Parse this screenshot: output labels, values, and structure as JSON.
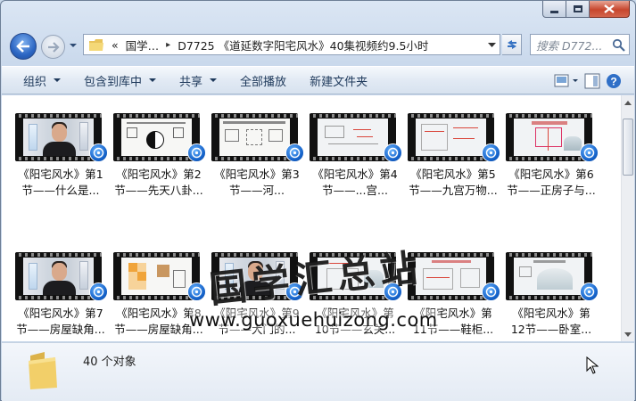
{
  "window": {
    "address": {
      "overflow": "«",
      "segments": [
        "国学…",
        "D7725 《道延数字阳宅风水》40集视频约9.5小时"
      ]
    },
    "search_placeholder": "搜索 D772..."
  },
  "toolbar": {
    "organize": "组织",
    "include_library": "包含到库中",
    "share": "共享",
    "play_all": "全部播放",
    "new_folder": "新建文件夹"
  },
  "items": [
    {
      "line1": "《阳宅风水》第1",
      "line2": "节——什么是..."
    },
    {
      "line1": "《阳宅风水》第2",
      "line2": "节——先天八卦..."
    },
    {
      "line1": "《阳宅风水》第3",
      "line2": "节——河..."
    },
    {
      "line1": "《阳宅风水》第4",
      "line2": "节——...宫..."
    },
    {
      "line1": "《阳宅风水》第5",
      "line2": "节——九宫万物..."
    },
    {
      "line1": "《阳宅风水》第6",
      "line2": "节——正房子与..."
    },
    {
      "line1": "《阳宅风水》第7",
      "line2": "节——房屋缺角..."
    },
    {
      "line1": "《阳宅风水》第8",
      "line2": "节——房屋缺角..."
    },
    {
      "line1": "《阳宅风水》第9",
      "line2": "节——大门的..."
    },
    {
      "line1": "《阳宅风水》第",
      "line2": "10节——玄关..."
    },
    {
      "line1": "《阳宅风水》第",
      "line2": "11节——鞋柜..."
    },
    {
      "line1": "《阳宅风水》第",
      "line2": "12节——卧室..."
    }
  ],
  "status": {
    "count": "40 个对象"
  },
  "watermark": {
    "title": "国学汇总站",
    "url": "www.guoxuehuizong.com"
  },
  "colors": {
    "accent": "#1260c8",
    "close": "#c7462d"
  }
}
